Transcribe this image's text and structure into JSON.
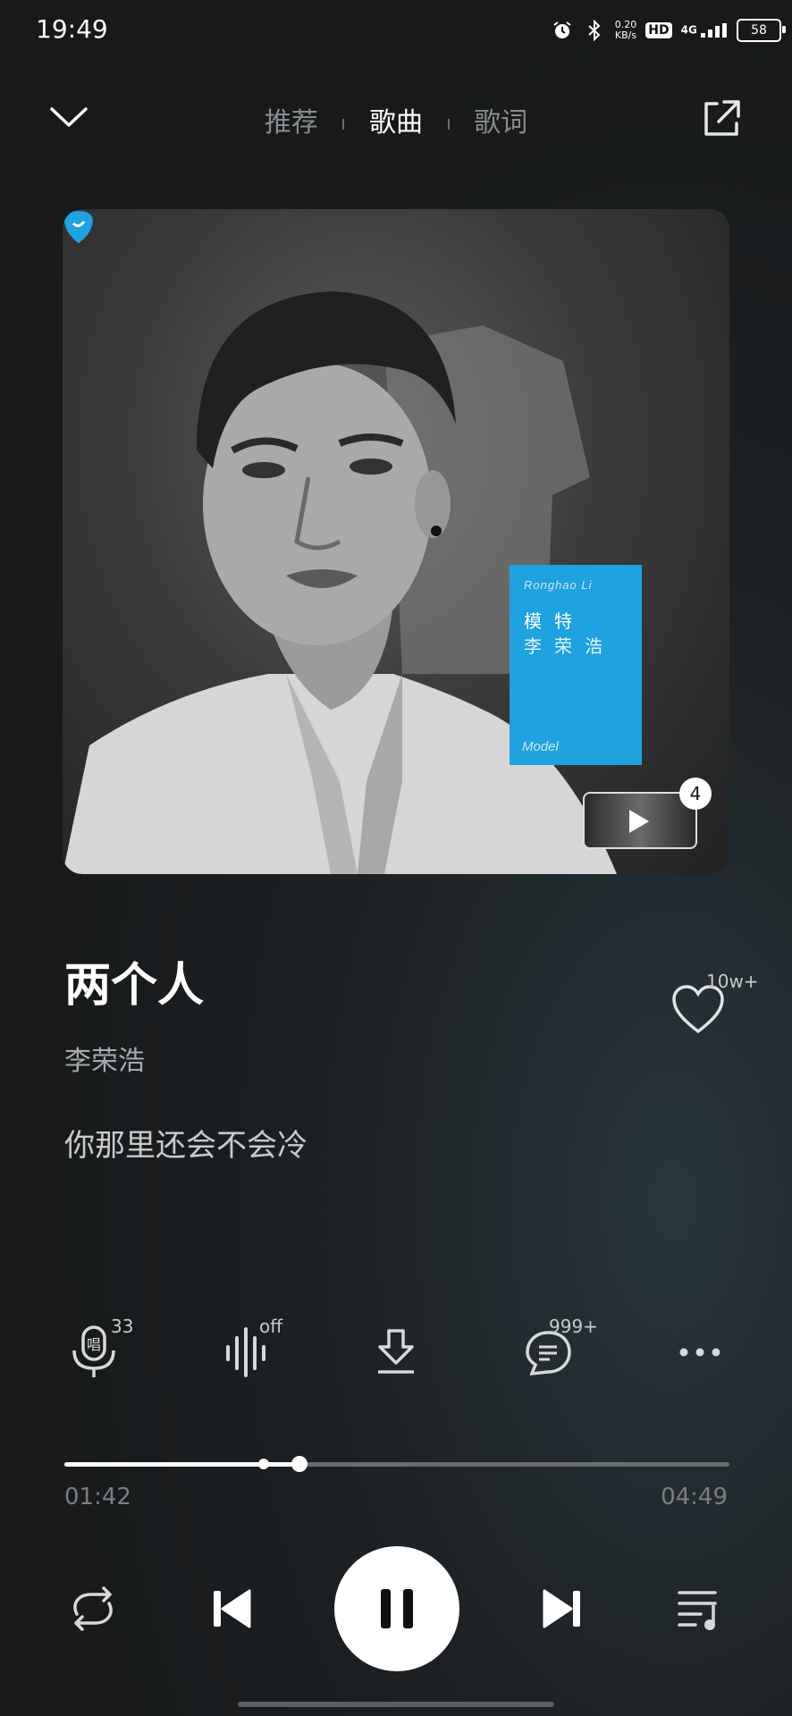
{
  "status_bar": {
    "time": "19:49",
    "net_speed_value": "0.20",
    "net_speed_unit": "KB/s",
    "hd_label": "HD",
    "network_label": "4G",
    "battery_level": "58"
  },
  "nav": {
    "tabs": [
      {
        "label": "推荐",
        "active": false
      },
      {
        "label": "歌曲",
        "active": true
      },
      {
        "label": "歌词",
        "active": false
      }
    ]
  },
  "album_art": {
    "artist_en": "Ronghao Li",
    "album_cn": "模特",
    "artist_cn": "李荣浩",
    "album_en": "Model",
    "accent_color": "#1ea2e0"
  },
  "mv": {
    "count": "4"
  },
  "song": {
    "title": "两个人",
    "artist": "李荣浩",
    "current_lyric": "你那里还会不会冷",
    "like_count": "10w+"
  },
  "actions": {
    "sing_count": "33",
    "sound_effect_state": "off",
    "comment_count": "999+"
  },
  "playback": {
    "current_time": "01:42",
    "total_time": "04:49",
    "progress_fraction": 0.353,
    "buffered_fraction": 0.3
  }
}
